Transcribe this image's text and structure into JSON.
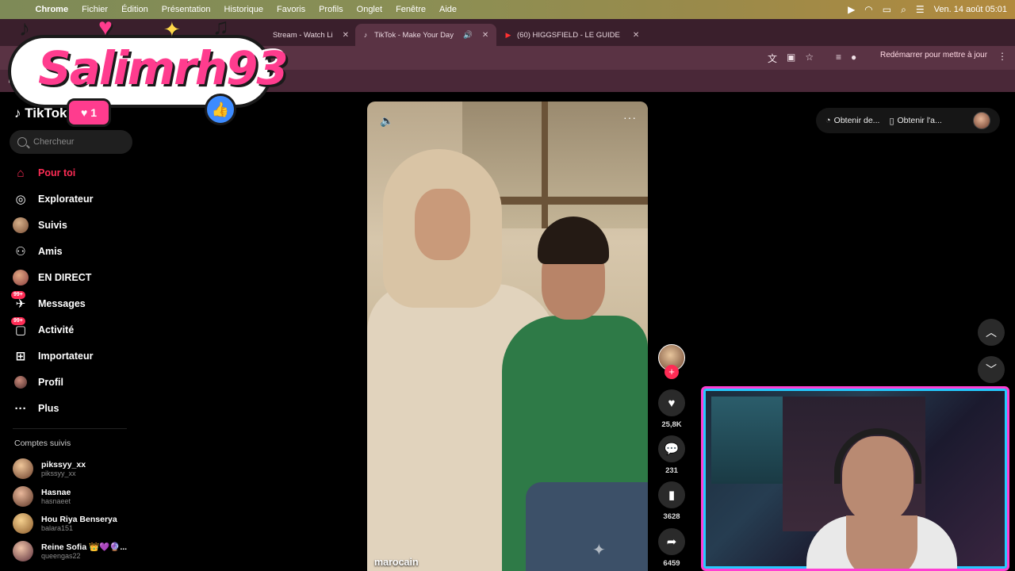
{
  "menubar": {
    "app": "Chrome",
    "items": [
      "Fichier",
      "Édition",
      "Présentation",
      "Historique",
      "Favoris",
      "Profils",
      "Onglet",
      "Fenêtre",
      "Aide"
    ],
    "clock": "Ven. 14 août 05:01"
  },
  "tabs": [
    {
      "title": "Stream - Watch Li"
    },
    {
      "title": "TikTok - Make Your Day"
    },
    {
      "title": "(60) HIGGSFIELD - LE GUIDE"
    }
  ],
  "toolbar": {
    "restart_label": "Redémarrer pour mettre à jour"
  },
  "overlay": {
    "logo_text": "Salimrh93",
    "like_count": "1"
  },
  "tiktok": {
    "logo": "TikTok",
    "search_placeholder": "Chercheur",
    "nav": [
      {
        "label": "Pour toi"
      },
      {
        "label": "Explorateur"
      },
      {
        "label": "Suivis"
      },
      {
        "label": "Amis"
      },
      {
        "label": "EN DIRECT"
      },
      {
        "label": "Messages",
        "badge": "99+"
      },
      {
        "label": "Activité",
        "badge": "99+"
      },
      {
        "label": "Importateur"
      },
      {
        "label": "Profil"
      },
      {
        "label": "Plus"
      }
    ],
    "accounts_title": "Comptes suivis",
    "accounts": [
      {
        "name": "pikssyy_xx",
        "handle": "pikssyy_xx"
      },
      {
        "name": "Hasnae",
        "handle": "hasnaeet"
      },
      {
        "name": "Hou Riya Benserya",
        "handle": "balara151"
      },
      {
        "name": "Reine Sofia 👑💜🔮...",
        "handle": "queengas22"
      }
    ],
    "video": {
      "caption": "marocain"
    },
    "actions": {
      "likes": "25,8K",
      "comments": "231",
      "saves": "3628",
      "shares": "6459"
    },
    "top_controls": {
      "desktop_label": "Obtenir de...",
      "app_label": "Obtenir l'a..."
    }
  }
}
